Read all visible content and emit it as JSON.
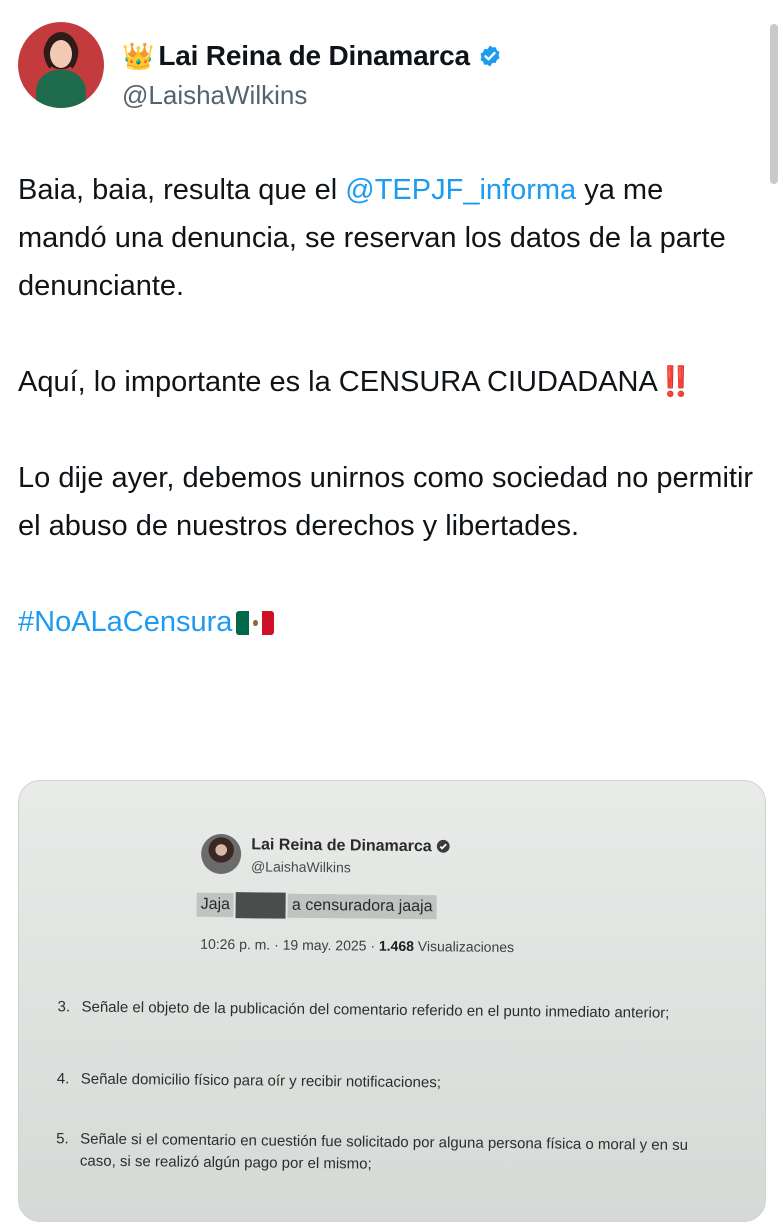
{
  "author": {
    "crown": "👑",
    "display_name": "Lai Reina de Dinamarca",
    "handle": "@LaishaWilkins"
  },
  "tweet": {
    "p1_before": "Baia, baia, resulta que el ",
    "p1_mention": "@TEPJF_informa",
    "p1_after": " ya me mandó una denuncia, se reservan los datos de la parte denunciante.",
    "p2_text": "Aquí, lo importante es la CENSURA CIUDADANA",
    "p2_emoji": "‼️",
    "p3_text": "Lo dije ayer, debemos unirnos como sociedad no permitir el abuso de nuestros derechos y libertades.",
    "hashtag": "#NoALaCensura",
    "flag_icon": "mexico-flag-icon"
  },
  "document": {
    "display_name": "Lai Reina de Dinamarca",
    "handle": "@LaishaWilkins",
    "post_before": "Jaja",
    "post_after": "a censuradora jaaja",
    "meta_time": "10:26 p. m. · 19 may. 2025 · ",
    "meta_views": "1.468",
    "meta_views_label": " Visualizaciones",
    "items": [
      {
        "num": "3.",
        "text": "Señale el objeto de la publicación del comentario referido en el punto inmediato anterior;"
      },
      {
        "num": "4.",
        "text": "Señale domicilio físico para oír y recibir notificaciones;"
      },
      {
        "num": "5.",
        "text": "Señale si el comentario en cuestión fue solicitado por alguna persona física o moral y en su caso, si se realizó algún pago por el mismo;"
      }
    ]
  },
  "colors": {
    "link": "#1d9bf0",
    "verified": "#1d9bf0",
    "secondary_text": "#536471"
  }
}
